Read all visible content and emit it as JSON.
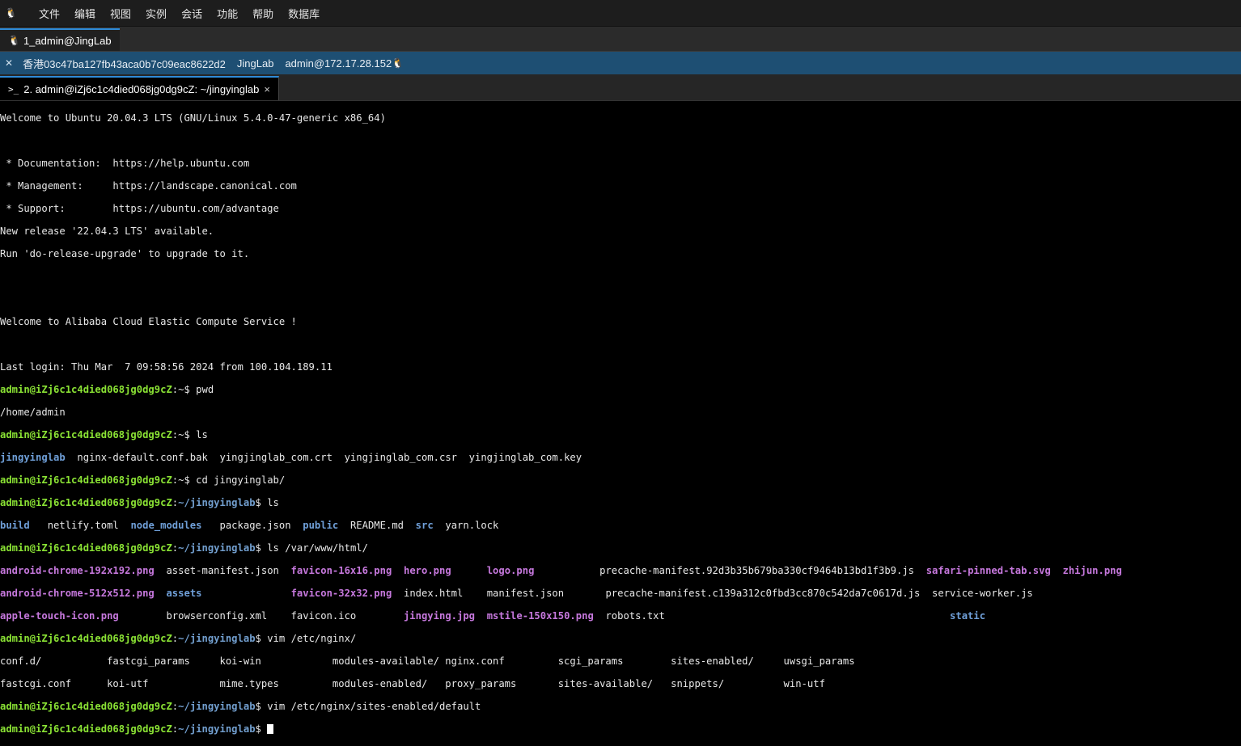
{
  "menu": {
    "logo": "🐧",
    "items": [
      "文件",
      "编辑",
      "视图",
      "实例",
      "会话",
      "功能",
      "帮助",
      "数据库"
    ]
  },
  "session_tab": {
    "icon": "🐧",
    "label": "1_admin@JingLab"
  },
  "info": {
    "close": "✕",
    "host_id": "香港03c47ba127fb43aca0b7c09eac8622d2",
    "name": "JingLab",
    "address": "admin@172.17.28.152",
    "icon": "🐧"
  },
  "terminal_tab": {
    "icon": ">_",
    "label": "2. admin@iZj6c1c4died068jg0dg9cZ: ~/jingyinglab",
    "close": "×"
  },
  "prompt": {
    "user": "admin@iZj6c1c4died068jg0dg9cZ",
    "home": ":~$ ",
    "proj_sep": ":",
    "proj_path": "~/jingyinglab",
    "proj_end": "$ "
  },
  "terminal": {
    "welcome": "Welcome to Ubuntu 20.04.3 LTS (GNU/Linux 5.4.0-47-generic x86_64)",
    "doc": " * Documentation:  https://help.ubuntu.com",
    "mgmt": " * Management:     https://landscape.canonical.com",
    "support": " * Support:        https://ubuntu.com/advantage",
    "release": "New release '22.04.3 LTS' available.",
    "upgrade": "Run 'do-release-upgrade' to upgrade to it.",
    "alibaba": "Welcome to Alibaba Cloud Elastic Compute Service !",
    "lastlogin": "Last login: Thu Mar  7 09:58:56 2024 from 100.104.189.11",
    "cmd_pwd": "pwd",
    "out_pwd": "/home/admin",
    "cmd_ls": "ls",
    "ls1_dir": "jingyinglab",
    "ls1_rest": "  nginx-default.conf.bak  yingjinglab_com.crt  yingjinglab_com.csr  yingjinglab_com.key",
    "cmd_cd": "cd jingyinglab/",
    "cmd_ls2": "ls",
    "ls2": {
      "build": "build",
      "netlify": "   netlify.toml  ",
      "node_modules": "node_modules",
      "package": "   package.json  ",
      "public": "public",
      "readme": "  README.md  ",
      "src": "src",
      "yarn": "  yarn.lock"
    },
    "cmd_lsvar": "ls /var/www/html/",
    "r1": {
      "a": "android-chrome-192x192.png",
      "b": "  asset-manifest.json  ",
      "c": "favicon-16x16.png",
      "d": "  ",
      "e": "hero.png",
      "f": "      ",
      "g": "logo.png",
      "h": "           precache-manifest.92d3b35b679ba330cf9464b13bd1f3b9.js  ",
      "i": "safari-pinned-tab.svg",
      "j": "  ",
      "k": "zhijun.png"
    },
    "r2": {
      "a": "android-chrome-512x512.png",
      "b": "  ",
      "c": "assets",
      "d": "               ",
      "e": "favicon-32x32.png",
      "f": "  index.html    manifest.json       precache-manifest.c139a312c0fbd3cc870c542da7c0617d.js  service-worker.js"
    },
    "r3": {
      "a": "apple-touch-icon.png",
      "b": "        browserconfig.xml    favicon.ico        ",
      "c": "jingying.jpg",
      "d": "  ",
      "e": "mstile-150x150.png",
      "f": "  robots.txt                                                ",
      "g": "static"
    },
    "cmd_vim1": "vim /etc/nginx/",
    "n1": "conf.d/           fastcgi_params     koi-win            modules-available/ nginx.conf         scgi_params        sites-enabled/     uwsgi_params",
    "n2": "fastcgi.conf      koi-utf            mime.types         modules-enabled/   proxy_params       sites-available/   snippets/          win-utf",
    "cmd_vim2": "vim /etc/nginx/sites-enabled/default"
  },
  "colors": {
    "user": "#8ae234",
    "directory": "#729fcf",
    "image": "#c678dd",
    "accent": "#2f8bd8",
    "infobar": "#1e4f73"
  }
}
